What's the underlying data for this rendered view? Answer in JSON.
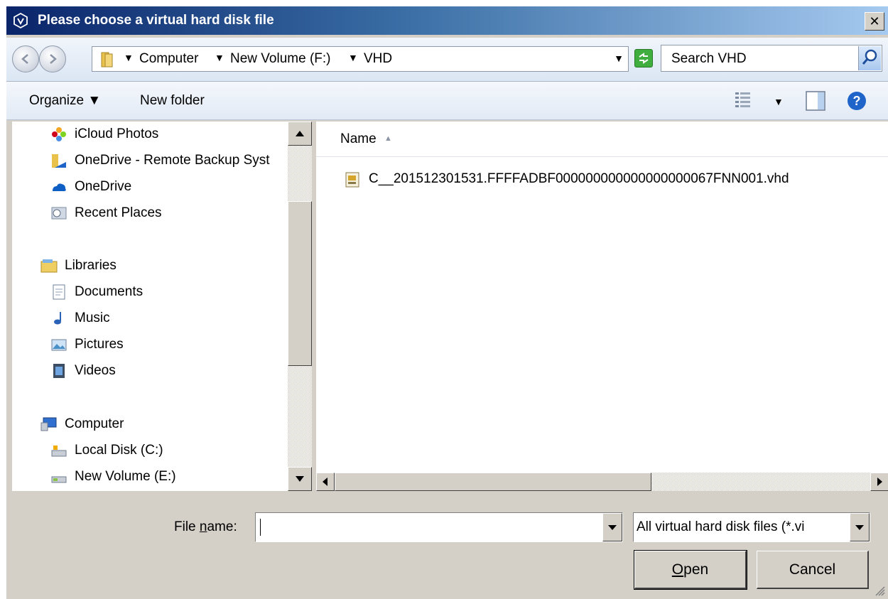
{
  "window": {
    "title": "Please choose a virtual hard disk file",
    "close_label": "✕"
  },
  "address": {
    "crumbs": [
      "Computer",
      "New Volume (F:)",
      "VHD"
    ],
    "search_placeholder": "Search VHD"
  },
  "toolbar": {
    "organize_label": "Organize ▼",
    "new_folder_label": "New folder"
  },
  "nav": {
    "items": [
      {
        "label": "iCloud Photos",
        "icon": "icloud-photos-icon"
      },
      {
        "label": "OneDrive - Remote Backup Syst",
        "icon": "onedrive-folder-icon"
      },
      {
        "label": "OneDrive",
        "icon": "onedrive-icon"
      },
      {
        "label": "Recent Places",
        "icon": "recent-places-icon"
      },
      {
        "label": "Libraries",
        "icon": "libraries-icon"
      },
      {
        "label": "Documents",
        "icon": "documents-icon"
      },
      {
        "label": "Music",
        "icon": "music-icon"
      },
      {
        "label": "Pictures",
        "icon": "pictures-icon"
      },
      {
        "label": "Videos",
        "icon": "videos-icon"
      },
      {
        "label": "Computer",
        "icon": "computer-icon"
      },
      {
        "label": "Local Disk (C:)",
        "icon": "local-disk-icon"
      },
      {
        "label": "New Volume (E:)",
        "icon": "drive-icon"
      }
    ]
  },
  "files": {
    "column_name": "Name",
    "items": [
      {
        "name": "C__201512301531.FFFFADBF000000000000000000067FNN001.vhd"
      }
    ]
  },
  "bottom": {
    "file_name_label_pre": "File ",
    "file_name_label_accel": "n",
    "file_name_label_post": "ame:",
    "file_name_value": "",
    "file_type_selected": "All virtual hard disk files (*.vi",
    "open_accel": "O",
    "open_rest": "pen",
    "cancel_label": "Cancel"
  },
  "colors": {
    "title_start": "#0a246a",
    "title_end": "#a6caf0",
    "dialog_bg": "#d4d0c8"
  }
}
